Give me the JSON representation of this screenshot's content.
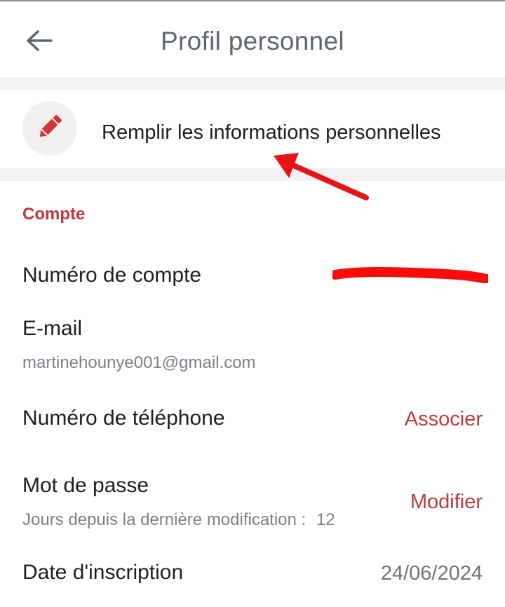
{
  "header": {
    "title": "Profil personnel",
    "back_icon": "arrow-left-icon"
  },
  "fill_info": {
    "label": "Remplir les informations personnelles",
    "icon": "pencil-icon"
  },
  "account": {
    "section_title": "Compte",
    "account_number_label": "Numéro de compte",
    "email_label": "E-mail",
    "email_value": "martinehounye001@gmail.com",
    "phone_label": "Numéro de téléphone",
    "phone_action": "Associer",
    "password_label": "Mot de passe",
    "password_days_text": "Jours depuis la dernière modification :",
    "password_days_value": "12",
    "password_action": "Modifier",
    "signup_label": "Date d'inscription",
    "signup_value": "24/06/2024"
  },
  "colors": {
    "accent": "#c0393b",
    "title_gray": "#5f6670",
    "annotation_red": "#e5141b",
    "band_gray": "#f2f2f4"
  }
}
